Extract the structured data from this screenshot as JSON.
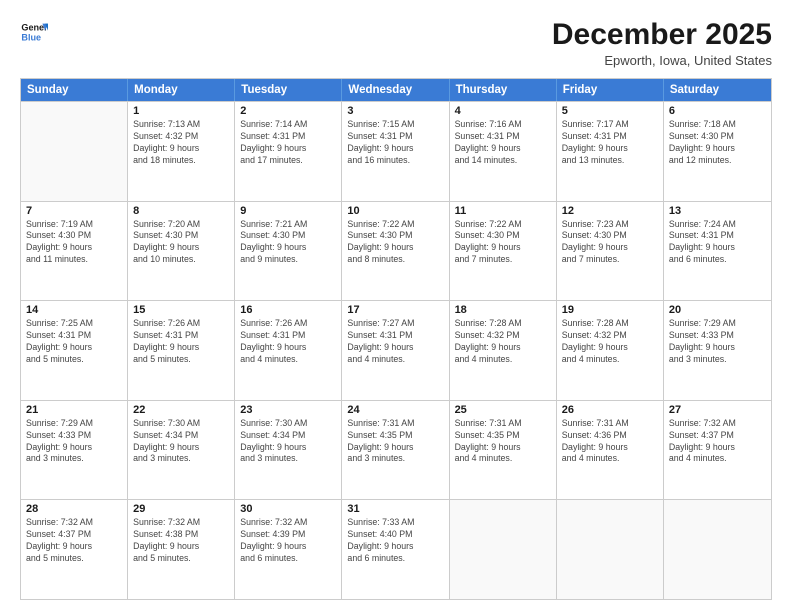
{
  "logo": {
    "line1": "General",
    "line2": "Blue"
  },
  "title": "December 2025",
  "subtitle": "Epworth, Iowa, United States",
  "header_days": [
    "Sunday",
    "Monday",
    "Tuesday",
    "Wednesday",
    "Thursday",
    "Friday",
    "Saturday"
  ],
  "rows": [
    [
      {
        "date": "",
        "info": ""
      },
      {
        "date": "1",
        "info": "Sunrise: 7:13 AM\nSunset: 4:32 PM\nDaylight: 9 hours\nand 18 minutes."
      },
      {
        "date": "2",
        "info": "Sunrise: 7:14 AM\nSunset: 4:31 PM\nDaylight: 9 hours\nand 17 minutes."
      },
      {
        "date": "3",
        "info": "Sunrise: 7:15 AM\nSunset: 4:31 PM\nDaylight: 9 hours\nand 16 minutes."
      },
      {
        "date": "4",
        "info": "Sunrise: 7:16 AM\nSunset: 4:31 PM\nDaylight: 9 hours\nand 14 minutes."
      },
      {
        "date": "5",
        "info": "Sunrise: 7:17 AM\nSunset: 4:31 PM\nDaylight: 9 hours\nand 13 minutes."
      },
      {
        "date": "6",
        "info": "Sunrise: 7:18 AM\nSunset: 4:30 PM\nDaylight: 9 hours\nand 12 minutes."
      }
    ],
    [
      {
        "date": "7",
        "info": "Sunrise: 7:19 AM\nSunset: 4:30 PM\nDaylight: 9 hours\nand 11 minutes."
      },
      {
        "date": "8",
        "info": "Sunrise: 7:20 AM\nSunset: 4:30 PM\nDaylight: 9 hours\nand 10 minutes."
      },
      {
        "date": "9",
        "info": "Sunrise: 7:21 AM\nSunset: 4:30 PM\nDaylight: 9 hours\nand 9 minutes."
      },
      {
        "date": "10",
        "info": "Sunrise: 7:22 AM\nSunset: 4:30 PM\nDaylight: 9 hours\nand 8 minutes."
      },
      {
        "date": "11",
        "info": "Sunrise: 7:22 AM\nSunset: 4:30 PM\nDaylight: 9 hours\nand 7 minutes."
      },
      {
        "date": "12",
        "info": "Sunrise: 7:23 AM\nSunset: 4:30 PM\nDaylight: 9 hours\nand 7 minutes."
      },
      {
        "date": "13",
        "info": "Sunrise: 7:24 AM\nSunset: 4:31 PM\nDaylight: 9 hours\nand 6 minutes."
      }
    ],
    [
      {
        "date": "14",
        "info": "Sunrise: 7:25 AM\nSunset: 4:31 PM\nDaylight: 9 hours\nand 5 minutes."
      },
      {
        "date": "15",
        "info": "Sunrise: 7:26 AM\nSunset: 4:31 PM\nDaylight: 9 hours\nand 5 minutes."
      },
      {
        "date": "16",
        "info": "Sunrise: 7:26 AM\nSunset: 4:31 PM\nDaylight: 9 hours\nand 4 minutes."
      },
      {
        "date": "17",
        "info": "Sunrise: 7:27 AM\nSunset: 4:31 PM\nDaylight: 9 hours\nand 4 minutes."
      },
      {
        "date": "18",
        "info": "Sunrise: 7:28 AM\nSunset: 4:32 PM\nDaylight: 9 hours\nand 4 minutes."
      },
      {
        "date": "19",
        "info": "Sunrise: 7:28 AM\nSunset: 4:32 PM\nDaylight: 9 hours\nand 4 minutes."
      },
      {
        "date": "20",
        "info": "Sunrise: 7:29 AM\nSunset: 4:33 PM\nDaylight: 9 hours\nand 3 minutes."
      }
    ],
    [
      {
        "date": "21",
        "info": "Sunrise: 7:29 AM\nSunset: 4:33 PM\nDaylight: 9 hours\nand 3 minutes."
      },
      {
        "date": "22",
        "info": "Sunrise: 7:30 AM\nSunset: 4:34 PM\nDaylight: 9 hours\nand 3 minutes."
      },
      {
        "date": "23",
        "info": "Sunrise: 7:30 AM\nSunset: 4:34 PM\nDaylight: 9 hours\nand 3 minutes."
      },
      {
        "date": "24",
        "info": "Sunrise: 7:31 AM\nSunset: 4:35 PM\nDaylight: 9 hours\nand 3 minutes."
      },
      {
        "date": "25",
        "info": "Sunrise: 7:31 AM\nSunset: 4:35 PM\nDaylight: 9 hours\nand 4 minutes."
      },
      {
        "date": "26",
        "info": "Sunrise: 7:31 AM\nSunset: 4:36 PM\nDaylight: 9 hours\nand 4 minutes."
      },
      {
        "date": "27",
        "info": "Sunrise: 7:32 AM\nSunset: 4:37 PM\nDaylight: 9 hours\nand 4 minutes."
      }
    ],
    [
      {
        "date": "28",
        "info": "Sunrise: 7:32 AM\nSunset: 4:37 PM\nDaylight: 9 hours\nand 5 minutes."
      },
      {
        "date": "29",
        "info": "Sunrise: 7:32 AM\nSunset: 4:38 PM\nDaylight: 9 hours\nand 5 minutes."
      },
      {
        "date": "30",
        "info": "Sunrise: 7:32 AM\nSunset: 4:39 PM\nDaylight: 9 hours\nand 6 minutes."
      },
      {
        "date": "31",
        "info": "Sunrise: 7:33 AM\nSunset: 4:40 PM\nDaylight: 9 hours\nand 6 minutes."
      },
      {
        "date": "",
        "info": ""
      },
      {
        "date": "",
        "info": ""
      },
      {
        "date": "",
        "info": ""
      }
    ]
  ]
}
